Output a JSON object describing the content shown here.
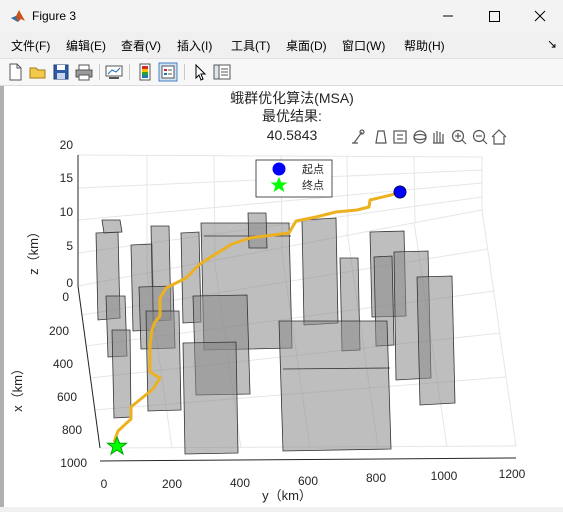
{
  "window": {
    "title": "Figure 3"
  },
  "menu": [
    {
      "label": "文件(F)"
    },
    {
      "label": "编辑(E)"
    },
    {
      "label": "查看(V)"
    },
    {
      "label": "插入(I)"
    },
    {
      "label": "工具(T)"
    },
    {
      "label": "桌面(D)"
    },
    {
      "label": "窗口(W)"
    },
    {
      "label": "帮助(H)"
    }
  ],
  "menu_overflow": "↘",
  "toolbar": [
    {
      "icon": "new-figure-icon"
    },
    {
      "icon": "open-file-icon"
    },
    {
      "icon": "save-icon"
    },
    {
      "icon": "print-icon"
    },
    {
      "icon": "link-plot-icon"
    },
    {
      "icon": "insert-colorbar-icon"
    },
    {
      "icon": "insert-legend-icon"
    },
    {
      "icon": "select-arrow-icon"
    },
    {
      "icon": "property-editor-icon"
    }
  ],
  "axes_toolbar": [
    {
      "icon": "brush-icon"
    },
    {
      "icon": "data-tip-icon"
    },
    {
      "icon": "legend-toggle-icon"
    },
    {
      "icon": "rotate-3d-icon"
    },
    {
      "icon": "pan-hand-icon"
    },
    {
      "icon": "zoom-in-icon"
    },
    {
      "icon": "zoom-out-icon"
    },
    {
      "icon": "home-icon"
    }
  ],
  "chart_data": {
    "type": "3d-scatter-line",
    "title": [
      "蛾群优化算法(MSA)",
      "最优结果:",
      "40.5843"
    ],
    "xlabel": "x（km）",
    "ylabel": "y（km）",
    "zlabel": "z（km）",
    "xlim": [
      0,
      1000
    ],
    "ylim": [
      0,
      1200
    ],
    "zlim": [
      0,
      20
    ],
    "x_ticks": [
      "0",
      "200",
      "400",
      "600",
      "800",
      "1000"
    ],
    "y_ticks": [
      "0",
      "200",
      "400",
      "600",
      "800",
      "1000",
      "1200"
    ],
    "z_ticks": [
      "0",
      "5",
      "10",
      "15",
      "20"
    ],
    "legend": [
      {
        "label": "起点",
        "marker": "circle",
        "color": "#0000ff"
      },
      {
        "label": "终点",
        "marker": "star",
        "color": "#00ff00"
      }
    ],
    "start_point": {
      "x": 0,
      "y": 900,
      "z": 15
    },
    "end_point": {
      "x": 1000,
      "y": 50,
      "z": 0
    },
    "obstacles_color": "#808080",
    "path_color": "#EDB120",
    "grid": true,
    "legend_placement": "top-center"
  }
}
